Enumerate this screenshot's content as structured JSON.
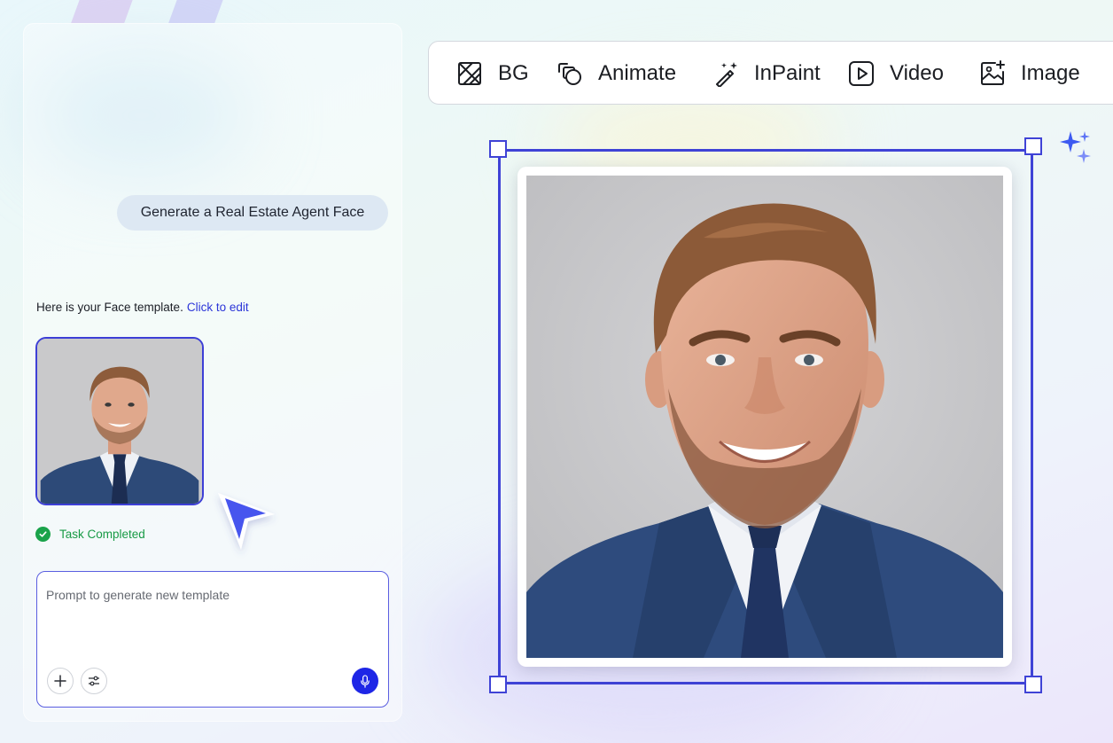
{
  "chat": {
    "user_message": "Generate a Real Estate Agent Face",
    "reply_text": "Here is your Face template.",
    "reply_link": "Click to edit",
    "status": "Task Completed"
  },
  "prompt": {
    "placeholder": "Prompt to generate new template"
  },
  "toolbar": {
    "items": [
      {
        "label": "BG",
        "icon": "remove-background-icon"
      },
      {
        "label": "Animate",
        "icon": "animate-icon"
      },
      {
        "label": "InPaint",
        "icon": "magic-wand-icon"
      },
      {
        "label": "Video",
        "icon": "play-video-icon"
      },
      {
        "label": "Image",
        "icon": "add-image-icon"
      }
    ]
  },
  "colors": {
    "accent": "#3f43d6",
    "link": "#2b35d8",
    "success": "#1aa34a",
    "mic_button": "#1e26e6",
    "bubble": "#dde8f3"
  }
}
